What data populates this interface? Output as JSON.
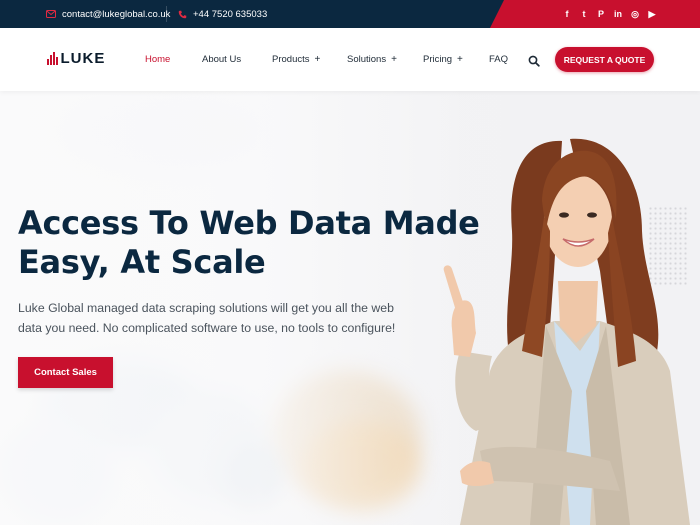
{
  "topbar": {
    "email": "contact@lukeglobal.co.uk",
    "phone": "+44 7520 635033",
    "socials": [
      {
        "name": "facebook-icon",
        "glyph": "f"
      },
      {
        "name": "twitter-icon",
        "glyph": "t"
      },
      {
        "name": "pinterest-icon",
        "glyph": "P"
      },
      {
        "name": "linkedin-icon",
        "glyph": "in"
      },
      {
        "name": "instagram-icon",
        "glyph": "◎"
      },
      {
        "name": "youtube-icon",
        "glyph": "▶"
      }
    ]
  },
  "nav": {
    "logo": "LUKE",
    "items": [
      {
        "label": "Home",
        "active": true,
        "plus": false
      },
      {
        "label": "About Us",
        "active": false,
        "plus": false
      },
      {
        "label": "Products",
        "active": false,
        "plus": true
      },
      {
        "label": "Solutions",
        "active": false,
        "plus": true
      },
      {
        "label": "Pricing",
        "active": false,
        "plus": true
      },
      {
        "label": "FAQ",
        "active": false,
        "plus": false
      }
    ],
    "plus_symbol": "+",
    "quote_button": "REQUEST A QUOTE"
  },
  "hero": {
    "title_line1": "Access To Web Data Made",
    "title_line2": "Easy, At Scale",
    "subtitle_line1": "Luke Global managed data scraping solutions will get you all the web",
    "subtitle_line2": "data you need. No complicated software to use, no tools to configure!",
    "cta": "Contact Sales"
  },
  "colors": {
    "brand_red": "#c8102e",
    "navy": "#0b2840"
  }
}
